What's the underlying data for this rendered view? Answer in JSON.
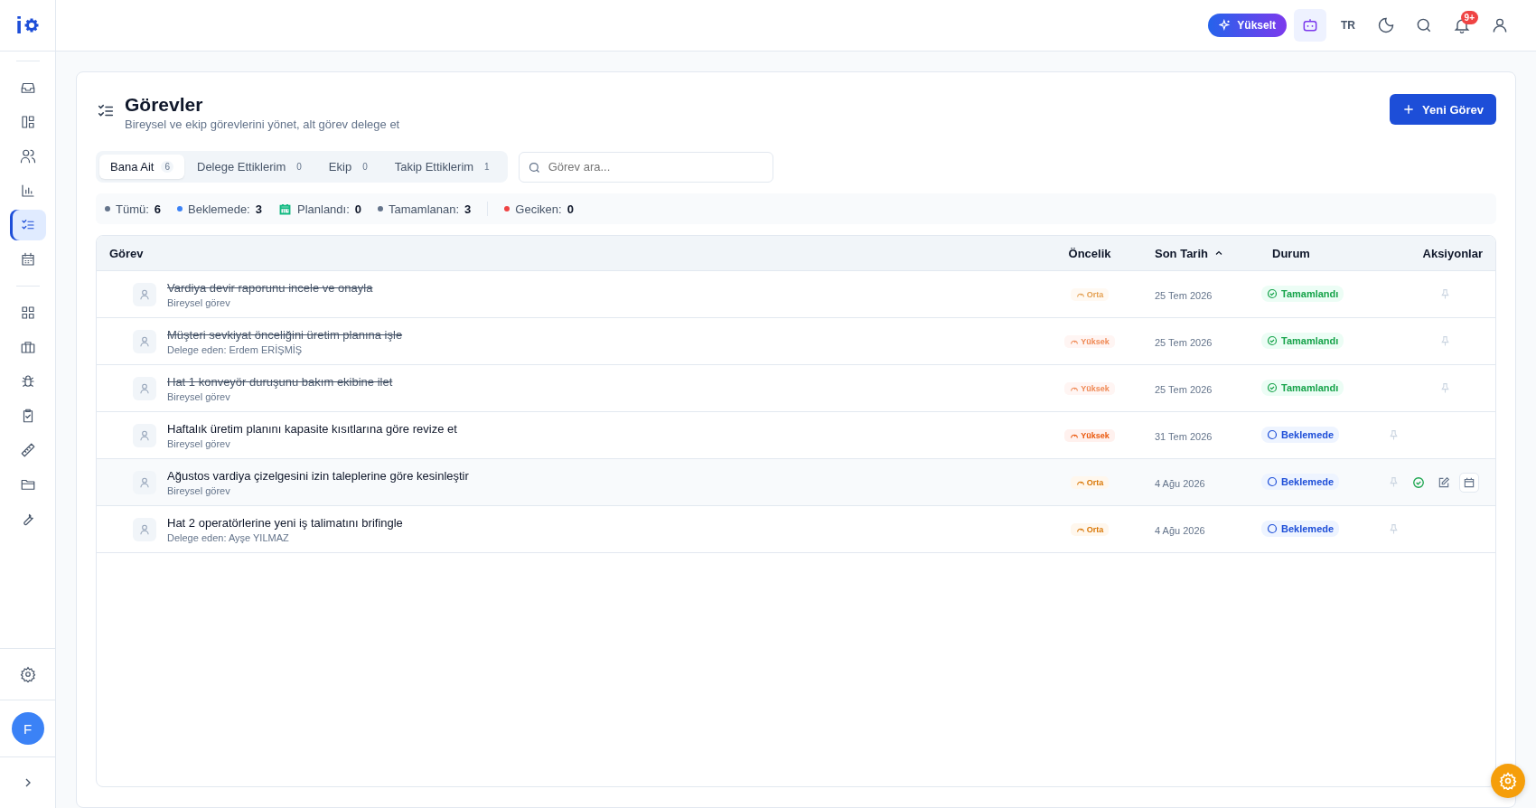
{
  "topbar": {
    "upgrade_button": "Yükselt",
    "language": "TR",
    "notification_badge": "9+"
  },
  "sidebar": {
    "logo": "i",
    "items": [
      {
        "selected": false
      },
      {
        "selected": false
      },
      {
        "selected": false
      },
      {
        "selected": false
      },
      {
        "selected": true
      },
      {
        "selected": false
      },
      {
        "selected": false
      },
      {
        "selected": false
      },
      {
        "selected": false
      },
      {
        "selected": false
      },
      {
        "selected": false
      },
      {
        "selected": false
      },
      {
        "selected": false
      }
    ],
    "avatar": "F"
  },
  "page": {
    "title": "Görevler",
    "subtitle": "Bireysel ve ekip görevlerini yönet, alt görev delege et",
    "new_button": "Yeni Görev"
  },
  "tabs": [
    {
      "label": "Bana Ait",
      "count": "6",
      "selected": true
    },
    {
      "label": "Delege Ettiklerim",
      "count": "0",
      "selected": false
    },
    {
      "label": "Ekip",
      "count": "0",
      "selected": false
    },
    {
      "label": "Takip Ettiklerim",
      "count": "1",
      "selected": false
    }
  ],
  "search": {
    "placeholder": "Görev ara..."
  },
  "stats": [
    {
      "label": "Tümü:",
      "value": "6",
      "kind": "dot",
      "color": "#64748b"
    },
    {
      "label": "Beklemede:",
      "value": "3",
      "kind": "dot",
      "color": "#3b82f6"
    },
    {
      "label": "Planlandı:",
      "value": "0",
      "kind": "calendar",
      "color": "#10b981"
    },
    {
      "label": "Tamamlanan:",
      "value": "3",
      "kind": "dot",
      "color": "#64748b"
    },
    {
      "label": "Geciken:",
      "value": "0",
      "kind": "dot",
      "color": "#ef4444"
    }
  ],
  "table": {
    "columns": [
      {
        "label": "Görev",
        "sorted": false
      },
      {
        "label": "Öncelik",
        "sorted": false
      },
      {
        "label": "Son Tarih",
        "sorted": true
      },
      {
        "label": "Durum",
        "sorted": false
      },
      {
        "label": "Aksiyonlar",
        "sorted": false
      }
    ],
    "rows": [
      {
        "title": "Vardiya devir raporunu incele ve onayla",
        "subtitle": "Bireysel görev",
        "done": true,
        "priority": {
          "label": "Orta",
          "kind": "medium"
        },
        "due": "25 Tem 2026",
        "status": {
          "label": "Tamamlandı",
          "kind": "done"
        },
        "hovered": false
      },
      {
        "title": "Müşteri sevkiyat önceliğini üretim planına işle",
        "subtitle": "Delege eden: Erdem ERİŞMİŞ",
        "done": true,
        "priority": {
          "label": "Yüksek",
          "kind": "high"
        },
        "due": "25 Tem 2026",
        "status": {
          "label": "Tamamlandı",
          "kind": "done"
        },
        "hovered": false
      },
      {
        "title": "Hat 1 konveyör duruşunu bakım ekibine ilet",
        "subtitle": "Bireysel görev",
        "done": true,
        "priority": {
          "label": "Yüksek",
          "kind": "high"
        },
        "due": "25 Tem 2026",
        "status": {
          "label": "Tamamlandı",
          "kind": "done"
        },
        "hovered": false
      },
      {
        "title": "Haftalık üretim planını kapasite kısıtlarına göre revize et",
        "subtitle": "Bireysel görev",
        "done": false,
        "priority": {
          "label": "Yüksek",
          "kind": "high"
        },
        "due": "31 Tem 2026",
        "status": {
          "label": "Beklemede",
          "kind": "pending"
        },
        "hovered": false
      },
      {
        "title": "Ağustos vardiya çizelgesini izin taleplerine göre kesinleştir",
        "subtitle": "Bireysel görev",
        "done": false,
        "priority": {
          "label": "Orta",
          "kind": "medium"
        },
        "due": "4 Ağu 2026",
        "status": {
          "label": "Beklemede",
          "kind": "pending"
        },
        "hovered": true
      },
      {
        "title": "Hat 2 operatörlerine yeni iş talimatını brifingle",
        "subtitle": "Delege eden: Ayşe YILMAZ",
        "done": false,
        "priority": {
          "label": "Orta",
          "kind": "medium"
        },
        "due": "4 Ağu 2026",
        "status": {
          "label": "Beklemede",
          "kind": "pending"
        },
        "hovered": false
      }
    ]
  }
}
